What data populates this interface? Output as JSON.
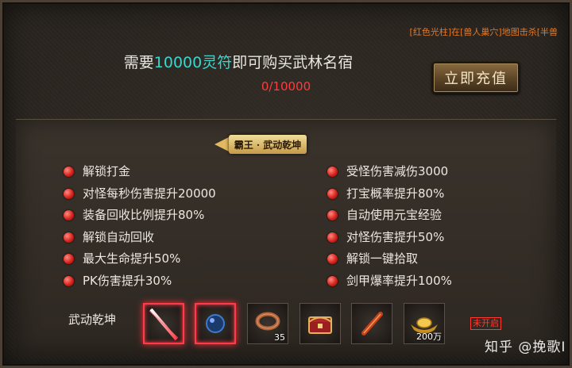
{
  "ticker": "[红色光柱]在[兽人巢穴]地图击杀[半兽",
  "requirement": {
    "prefix": "需要",
    "amount": "10000灵符",
    "suffix": "即可购买武林名宿"
  },
  "progress": "0/10000",
  "recharge_label": "立即充值",
  "banner_title": "霸王 · 武动乾坤",
  "perks_left": [
    "解锁打金",
    "对怪每秒伤害提升20000",
    "装备回收比例提升80%",
    "解锁自动回收",
    "最大生命提升50%",
    "PK伤害提升30%"
  ],
  "perks_right": [
    "受怪伤害减伤3000",
    "打宝概率提升80%",
    "自动使用元宝经验",
    "对怪伤害提升50%",
    "解锁一键拾取",
    "剑甲爆率提升100%"
  ],
  "rewards_label": "武动乾坤",
  "rewards": [
    {
      "icon": "sword-icon",
      "count": ""
    },
    {
      "icon": "orb-icon",
      "count": ""
    },
    {
      "icon": "ring-icon",
      "count": "35"
    },
    {
      "icon": "chest-icon",
      "count": ""
    },
    {
      "icon": "scroll-icon",
      "count": ""
    },
    {
      "icon": "gold-ingot-icon",
      "count": "200万"
    }
  ],
  "status": "未开启",
  "watermark": "知乎 @挽歌I"
}
